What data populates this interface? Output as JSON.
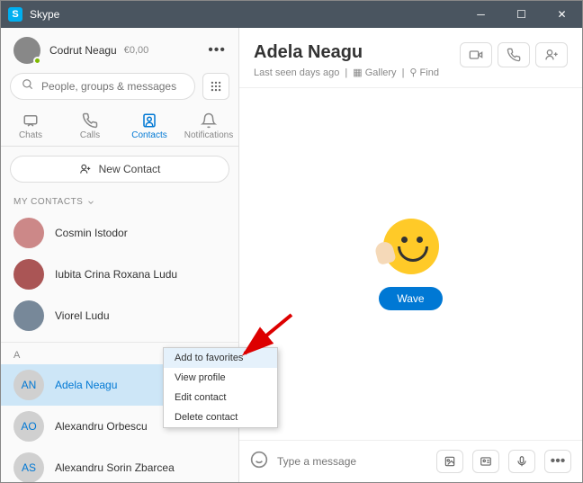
{
  "titlebar": {
    "app": "S",
    "title": "Skype"
  },
  "profile": {
    "name": "Codrut Neagu",
    "balance": "€0,00"
  },
  "search": {
    "placeholder": "People, groups & messages"
  },
  "tabs": {
    "chats": "Chats",
    "calls": "Calls",
    "contacts": "Contacts",
    "notifications": "Notifications"
  },
  "newContact": "New Contact",
  "sections": {
    "myContacts": "MY CONTACTS"
  },
  "contacts": {
    "fav": [
      {
        "name": "Cosmin Istodor"
      },
      {
        "name": "Iubita Crina Roxana Ludu"
      },
      {
        "name": "Viorel Ludu"
      }
    ],
    "letterA": "A",
    "a": [
      {
        "initials": "AN",
        "name": "Adela Neagu"
      },
      {
        "initials": "AO",
        "name": "Alexandru Orbescu"
      },
      {
        "initials": "AS",
        "name": "Alexandru Sorin Zbarcea"
      }
    ]
  },
  "chat": {
    "title": "Adela Neagu",
    "lastSeen": "Last seen days ago",
    "gallery": "Gallery",
    "find": "Find",
    "wave": "Wave",
    "msgPlaceholder": "Type a message"
  },
  "contextMenu": {
    "addFav": "Add to favorites",
    "viewProfile": "View profile",
    "editContact": "Edit contact",
    "deleteContact": "Delete contact"
  }
}
